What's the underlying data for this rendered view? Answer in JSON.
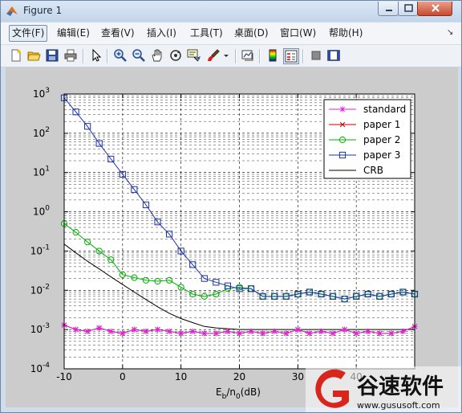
{
  "window": {
    "title": "Figure 1"
  },
  "menu": {
    "items": [
      "文件(F)",
      "编辑(E)",
      "查看(V)",
      "插入(I)",
      "工具(T)",
      "桌面(D)",
      "窗口(W)",
      "帮助(H)"
    ]
  },
  "toolbar": {
    "icons": [
      "new-figure-icon",
      "open-file-icon",
      "save-icon",
      "print-icon",
      "pointer-icon",
      "zoom-in-icon",
      "zoom-out-icon",
      "pan-icon",
      "rotate-3d-icon",
      "data-cursor-icon",
      "brush-icon",
      "link-plot-icon",
      "colorbar-icon",
      "legend-icon",
      "hide-plot-tools-icon",
      "show-plot-tools-icon"
    ]
  },
  "watermark": {
    "brand": "谷速软件",
    "url": "www.gususoft.com"
  },
  "chart_data": {
    "type": "line",
    "xlabel_main": "E",
    "xlabel_sub1": "b",
    "xlabel_mid": "/n",
    "xlabel_sub2": "0",
    "xlabel_tail": "(dB)",
    "ylabel": "",
    "xlim": [
      -10,
      50
    ],
    "ylim_log10": [
      -4,
      3
    ],
    "yscale": "log",
    "grid": true,
    "legend_position": "top-right",
    "xtick_labels": [
      "-10",
      "0",
      "10",
      "20",
      "30",
      "40"
    ],
    "ytick_base": "10",
    "ytick_exponents": [
      "3",
      "2",
      "1",
      "0",
      "-1",
      "-2",
      "-3",
      "-4"
    ],
    "x": [
      -10,
      -8,
      -6,
      -4,
      -2,
      0,
      2,
      4,
      6,
      8,
      10,
      12,
      14,
      16,
      18,
      20,
      22,
      24,
      26,
      28,
      30,
      32,
      34,
      36,
      38,
      40,
      42,
      44,
      46,
      48,
      50
    ],
    "series": [
      {
        "name": "standard",
        "color": "#e020e0",
        "marker": "star",
        "values": [
          0.0013,
          0.001,
          0.0009,
          0.0011,
          0.0009,
          0.0008,
          0.001,
          0.0009,
          0.001,
          0.0009,
          0.0008,
          0.0009,
          0.0008,
          0.0008,
          0.0009,
          0.0008,
          0.0009,
          0.0008,
          0.0009,
          0.0008,
          0.001,
          0.0008,
          0.0009,
          0.0008,
          0.001,
          0.0008,
          0.0009,
          0.0008,
          0.0008,
          0.0009,
          0.0012
        ]
      },
      {
        "name": "paper 1",
        "color": "#c00000",
        "marker": "x",
        "values": [
          0.0013,
          0.001,
          0.0009,
          0.0011,
          0.0009,
          0.0008,
          0.001,
          0.0009,
          0.001,
          0.0009,
          0.0008,
          0.0009,
          0.0008,
          0.0008,
          0.0009,
          0.0008,
          0.0009,
          0.0008,
          0.0009,
          0.0008,
          0.001,
          0.0008,
          0.0009,
          0.0008,
          0.001,
          0.0008,
          0.0009,
          0.0008,
          0.0008,
          0.0009,
          0.0012
        ]
      },
      {
        "name": "paper 2",
        "color": "#00b000",
        "marker": "circle",
        "values": [
          0.5,
          0.3,
          0.17,
          0.1,
          0.06,
          0.025,
          0.021,
          0.018,
          0.017,
          0.018,
          0.012,
          0.008,
          0.007,
          0.008,
          0.011,
          0.012,
          0.011,
          0.007,
          0.007,
          0.007,
          0.008,
          0.009,
          0.008,
          0.007,
          0.006,
          0.007,
          0.008,
          0.007,
          0.008,
          0.009,
          0.008
        ]
      },
      {
        "name": "paper 3",
        "color": "#1a33a8",
        "marker": "square",
        "values": [
          800,
          350,
          150,
          55,
          22,
          9,
          3.7,
          1.5,
          0.55,
          0.27,
          0.1,
          0.045,
          0.02,
          0.016,
          0.013,
          0.011,
          0.011,
          0.007,
          0.007,
          0.007,
          0.008,
          0.009,
          0.008,
          0.007,
          0.006,
          0.007,
          0.008,
          0.007,
          0.008,
          0.009,
          0.008
        ]
      },
      {
        "name": "CRB",
        "color": "#000000",
        "marker": "none",
        "values": [
          0.15,
          0.09,
          0.055,
          0.035,
          0.022,
          0.014,
          0.009,
          0.0058,
          0.0038,
          0.0026,
          0.0019,
          0.0015,
          0.0012,
          0.0011,
          0.00105,
          0.001,
          0.001,
          0.001,
          0.001,
          0.001,
          0.001,
          0.001,
          0.001,
          0.001,
          0.001,
          0.001,
          0.001,
          0.001,
          0.001,
          0.001,
          0.001
        ]
      }
    ]
  }
}
